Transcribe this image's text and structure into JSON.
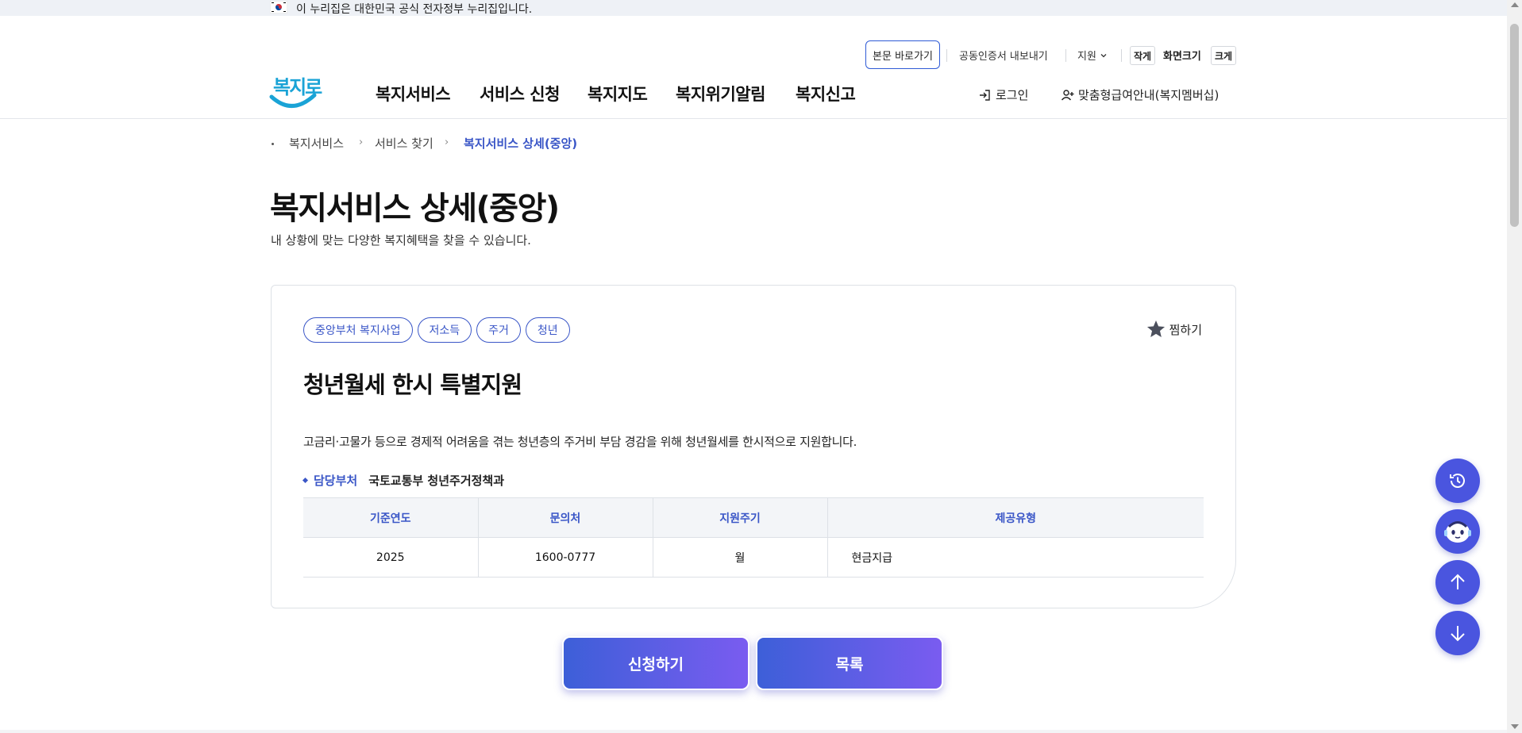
{
  "gov_banner": {
    "text": "이 누리집은 대한민국 공식 전자정부 누리집입니다."
  },
  "header": {
    "skip_link": "본문 바로가기",
    "cert_export": "공동인증서 내보내기",
    "support": "지원",
    "font_small": "작게",
    "font_size_label": "화면크기",
    "font_large": "크게",
    "logo_text": "복지로",
    "nav": [
      "복지서비스",
      "서비스 신청",
      "복지지도",
      "복지위기알림",
      "복지신고"
    ],
    "login": "로그인",
    "membership": "맞춤형급여안내(복지멤버십)"
  },
  "breadcrumb": [
    "복지서비스",
    "서비스 찾기",
    "복지서비스 상세(중앙)"
  ],
  "page": {
    "title": "복지서비스 상세(중앙)",
    "description": "내 상황에 맞는 다양한 복지혜택을 찾을 수 있습니다."
  },
  "service": {
    "tags": [
      "중앙부처 복지사업",
      "저소득",
      "주거",
      "청년"
    ],
    "favorite_label": "찜하기",
    "title": "청년월세 한시 특별지원",
    "description": "고금리·고물가 등으로 경제적 어려움을 겪는 청년층의 주거비 부담 경감을 위해 청년월세를 한시적으로 지원합니다.",
    "dept_label": "담당부처",
    "dept_value": "국토교통부 청년주거정책과",
    "table": {
      "headers": [
        "기준연도",
        "문의처",
        "지원주기",
        "제공유형"
      ],
      "rows": [
        [
          "2025",
          "1600-0777",
          "월",
          "현금지급"
        ]
      ]
    }
  },
  "actions": {
    "apply": "신청하기",
    "list": "목록"
  },
  "colors": {
    "accent": "#3a56c7",
    "button_gradient_start": "#3d5fd8",
    "button_gradient_end": "#7a5cf0",
    "float_button": "#4a55df"
  },
  "icons": {
    "flag": "korea-flag-icon",
    "login": "login-icon",
    "member": "user-add-icon",
    "favorite": "star-icon",
    "recent": "history-icon",
    "chatbot": "chatbot-icon",
    "top": "arrow-up-icon",
    "bottom": "arrow-down-icon"
  }
}
